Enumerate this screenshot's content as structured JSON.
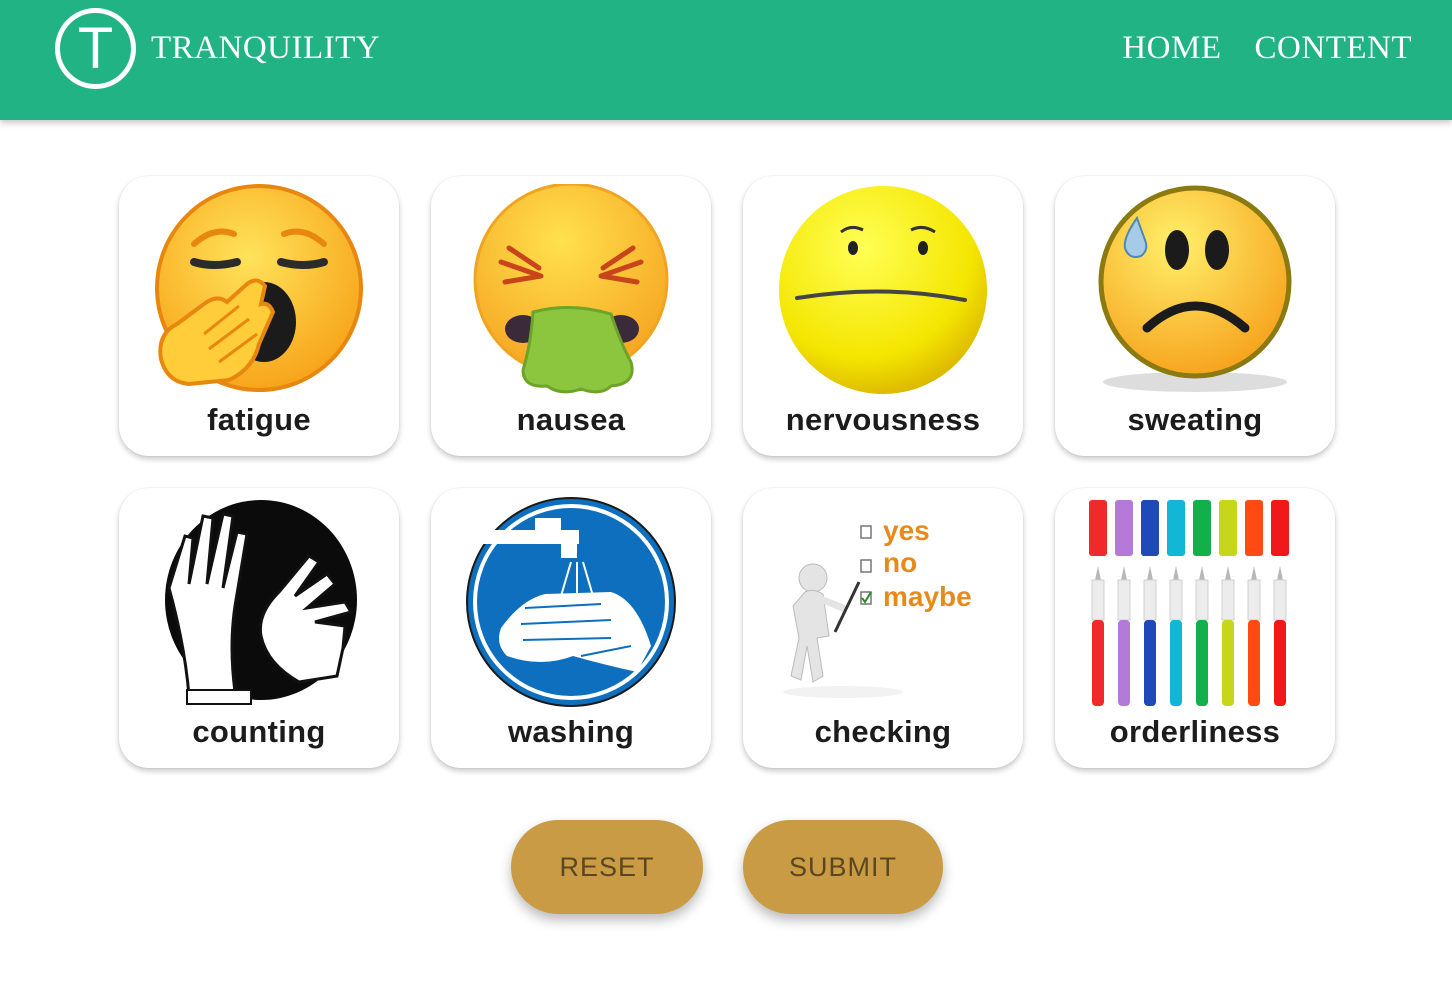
{
  "nav": {
    "logo_letter": "T",
    "brand": "TRANQUILITY",
    "links": [
      "HOME",
      "CONTENT"
    ]
  },
  "symptoms": [
    {
      "label": "fatigue",
      "icon": "yawning-face-icon"
    },
    {
      "label": "nausea",
      "icon": "vomiting-face-icon"
    },
    {
      "label": "nervousness",
      "icon": "worried-face-icon"
    },
    {
      "label": "sweating",
      "icon": "sweating-face-icon"
    },
    {
      "label": "counting",
      "icon": "counting-hands-icon"
    },
    {
      "label": "washing",
      "icon": "hand-washing-icon"
    },
    {
      "label": "checking",
      "icon": "checklist-figure-icon"
    },
    {
      "label": "orderliness",
      "icon": "ordered-pens-icon"
    }
  ],
  "checklist_options": [
    "yes",
    "no",
    "maybe"
  ],
  "buttons": {
    "reset": "RESET",
    "submit": "SUBMIT"
  },
  "colors": {
    "header": "#21b384",
    "button": "#c99b45",
    "button_text": "#5a4721"
  }
}
